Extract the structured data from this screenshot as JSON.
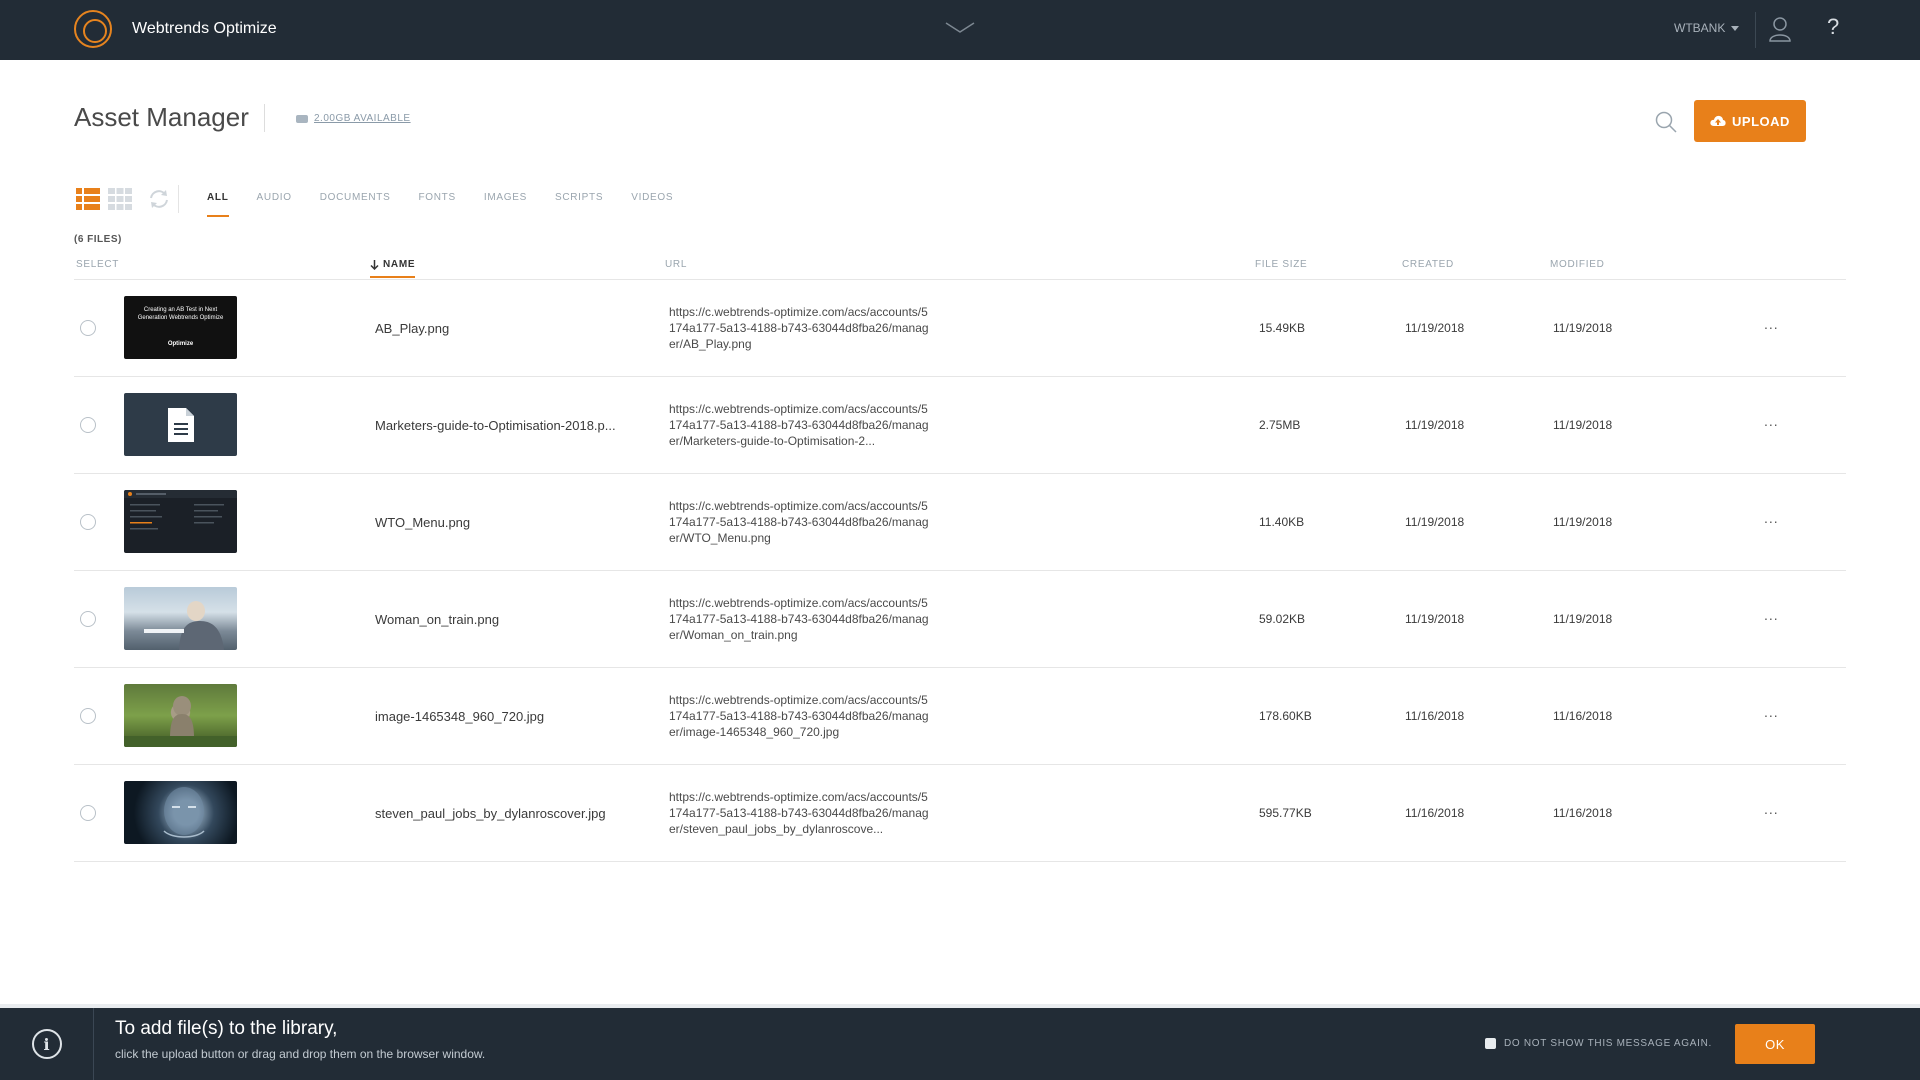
{
  "nav": {
    "app_name": "Webtrends Optimize",
    "account": "WTBANK",
    "help": "?"
  },
  "header": {
    "title": "Asset Manager",
    "storage": "2.00GB AVAILABLE",
    "upload_label": "UPLOAD"
  },
  "tabs": [
    {
      "label": "ALL",
      "active": true
    },
    {
      "label": "AUDIO"
    },
    {
      "label": "DOCUMENTS"
    },
    {
      "label": "FONTS"
    },
    {
      "label": "IMAGES"
    },
    {
      "label": "SCRIPTS"
    },
    {
      "label": "VIDEOS"
    }
  ],
  "file_count": "(6 FILES)",
  "columns": {
    "select": "SELECT",
    "name": "NAME",
    "url": "URL",
    "size": "FILE SIZE",
    "created": "CREATED",
    "modified": "MODIFIED"
  },
  "files": [
    {
      "name": "AB_Play.png",
      "url": "https://c.webtrends-optimize.com/acs/accounts/5174a177-5a13-4188-b743-63044d8fba26/manager/AB_Play.png",
      "size": "15.49KB",
      "created": "11/19/2018",
      "modified": "11/19/2018",
      "thumb": "dark-slide",
      "thumb_text": "Creating an AB Test in Next Generation Webtrends Optimize",
      "thumb_brand": "Optimize"
    },
    {
      "name": "Marketers-guide-to-Optimisation-2018.p...",
      "url": "https://c.webtrends-optimize.com/acs/accounts/5174a177-5a13-4188-b743-63044d8fba26/manager/Marketers-guide-to-Optimisation-2...",
      "size": "2.75MB",
      "created": "11/19/2018",
      "modified": "11/19/2018",
      "thumb": "document-icon"
    },
    {
      "name": "WTO_Menu.png",
      "url": "https://c.webtrends-optimize.com/acs/accounts/5174a177-5a13-4188-b743-63044d8fba26/manager/WTO_Menu.png",
      "size": "11.40KB",
      "created": "11/19/2018",
      "modified": "11/19/2018",
      "thumb": "menu-screenshot"
    },
    {
      "name": "Woman_on_train.png",
      "url": "https://c.webtrends-optimize.com/acs/accounts/5174a177-5a13-4188-b743-63044d8fba26/manager/Woman_on_train.png",
      "size": "59.02KB",
      "created": "11/19/2018",
      "modified": "11/19/2018",
      "thumb": "photo-train"
    },
    {
      "name": "image-1465348_960_720.jpg",
      "url": "https://c.webtrends-optimize.com/acs/accounts/5174a177-5a13-4188-b743-63044d8fba26/manager/image-1465348_960_720.jpg",
      "size": "178.60KB",
      "created": "11/16/2018",
      "modified": "11/16/2018",
      "thumb": "photo-statue"
    },
    {
      "name": "steven_paul_jobs_by_dylanroscover.jpg",
      "url": "https://c.webtrends-optimize.com/acs/accounts/5174a177-5a13-4188-b743-63044d8fba26/manager/steven_paul_jobs_by_dylanroscove...",
      "size": "595.77KB",
      "created": "11/16/2018",
      "modified": "11/16/2018",
      "thumb": "photo-portrait"
    }
  ],
  "row_menu": "...",
  "message": {
    "title": "To add file(s) to the library,",
    "subtitle": "click the upload button or drag and drop them on the browser window.",
    "dont_show": "DO NOT SHOW THIS MESSAGE AGAIN.",
    "ok_label": "OK",
    "info_glyph": "i"
  },
  "colors": {
    "accent": "#e8801a",
    "nav_bg": "#222c36"
  }
}
